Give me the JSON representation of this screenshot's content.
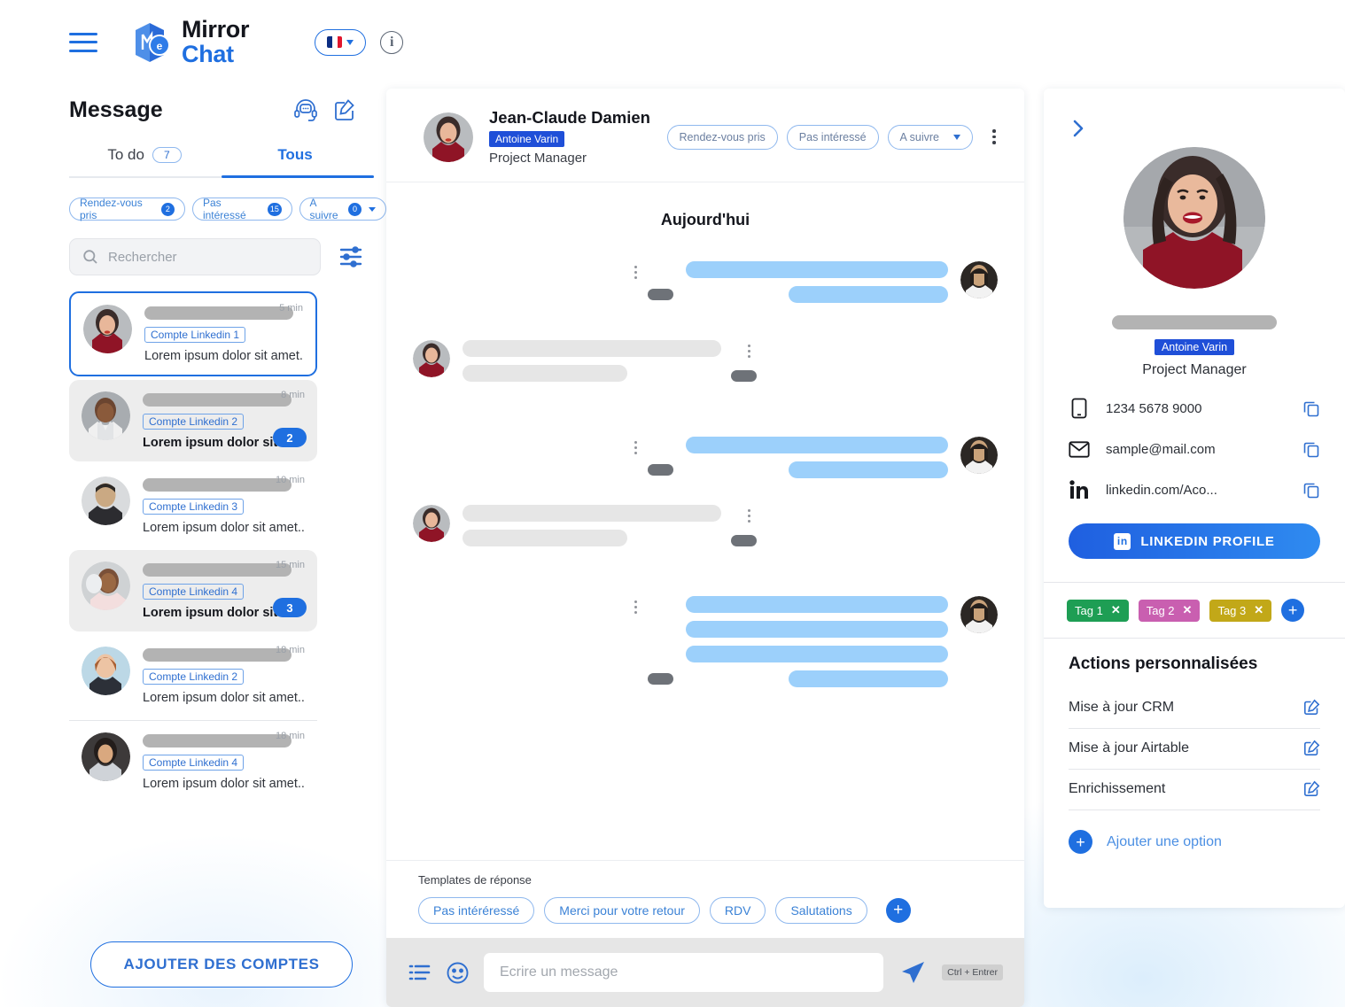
{
  "app": {
    "logo_line1": "Mirror",
    "logo_line2": "Chat",
    "language": "fr"
  },
  "sidebar": {
    "title": "Message",
    "icons": {
      "support": "headset-chat-icon",
      "compose": "compose-icon"
    },
    "tabs": [
      {
        "label": "To do",
        "count": "7",
        "active": false
      },
      {
        "label": "Tous",
        "count": "",
        "active": true
      }
    ],
    "filter_chips": [
      {
        "label": "Rendez-vous pris",
        "count": "2",
        "dropdown": false
      },
      {
        "label": "Pas intéressé",
        "count": "15",
        "dropdown": false
      },
      {
        "label": "A suivre",
        "count": "0",
        "dropdown": true
      }
    ],
    "search": {
      "placeholder": "Rechercher",
      "value": ""
    },
    "filter_icon": "sliders-icon",
    "conversations": [
      {
        "account": "Compte Linkedin 1",
        "preview": "Lorem ipsum dolor sit amet...",
        "time": "5 min",
        "unread": "",
        "state": "selected"
      },
      {
        "account": "Compte Linkedin 2",
        "preview": "Lorem ipsum dolor sit...",
        "time": "8 min",
        "unread": "2",
        "state": "unread"
      },
      {
        "account": "Compte Linkedin 3",
        "preview": "Lorem ipsum dolor sit amet...",
        "time": "10 min",
        "unread": "",
        "state": "normal"
      },
      {
        "account": "Compte Linkedin 4",
        "preview": "Lorem ipsum dolor sit...",
        "time": "15 min",
        "unread": "3",
        "state": "unread"
      },
      {
        "account": "Compte Linkedin 2",
        "preview": "Lorem ipsum dolor sit amet...",
        "time": "18 min",
        "unread": "",
        "state": "normal"
      },
      {
        "account": "Compte Linkedin 4",
        "preview": "Lorem ipsum dolor sit amet...",
        "time": "18 min",
        "unread": "",
        "state": "divider"
      }
    ],
    "add_accounts_label": "AJOUTER DES COMPTES"
  },
  "chat": {
    "contact_name": "Jean-Claude Damien",
    "contact_tag": "Antoine Varin",
    "contact_role": "Project Manager",
    "status_chips": [
      {
        "label": "Rendez-vous pris",
        "dropdown": false
      },
      {
        "label": "Pas intéressé",
        "dropdown": false
      },
      {
        "label": "A suivre",
        "dropdown": true
      }
    ],
    "day_label": "Aujourd'hui",
    "templates_label": "Templates de réponse",
    "templates": [
      "Pas intéréressé",
      "Merci pour votre retour",
      "RDV",
      "Salutations"
    ],
    "composer": {
      "placeholder": "Ecrire un message",
      "value": "",
      "shortcut": "Ctrl + Entrer"
    }
  },
  "profile": {
    "badge": "Antoine Varin",
    "role": "Project Manager",
    "fields": [
      {
        "icon": "phone-icon",
        "value": "1234 5678 9000"
      },
      {
        "icon": "mail-icon",
        "value": "sample@mail.com"
      },
      {
        "icon": "linkedin-icon",
        "value": "linkedin.com/Aco..."
      }
    ],
    "linkedin_button": "LINKEDIN PROFILE",
    "tags": [
      {
        "label": "Tag 1",
        "color": "#1E9E54"
      },
      {
        "label": "Tag 2",
        "color": "#C95FB0"
      },
      {
        "label": "Tag 3",
        "color": "#C2A818"
      }
    ],
    "actions_title": "Actions personnalisées",
    "actions": [
      "Mise à jour CRM",
      "Mise à jour Airtable",
      "Enrichissement"
    ],
    "add_option_label": "Ajouter une option"
  },
  "colors": {
    "accent": "#1f6fe0",
    "bubble_out": "#9cd0fb",
    "bubble_in": "#e6e6e6",
    "composer_bg": "#e6e6e6"
  }
}
